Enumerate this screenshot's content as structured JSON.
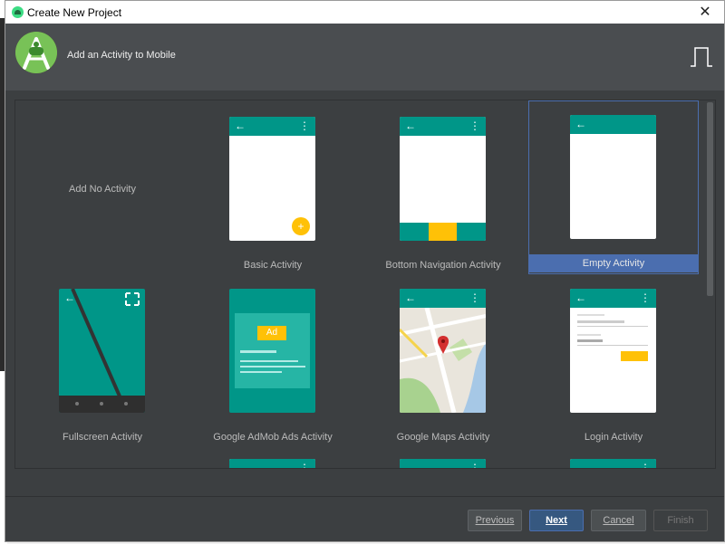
{
  "window": {
    "title": "Create New Project"
  },
  "header": {
    "title": "Add an Activity to Mobile"
  },
  "activities": [
    {
      "name": "Add No Activity",
      "selected": false
    },
    {
      "name": "Basic Activity",
      "selected": false
    },
    {
      "name": "Bottom Navigation Activity",
      "selected": false
    },
    {
      "name": "Empty Activity",
      "selected": true
    },
    {
      "name": "Fullscreen Activity",
      "selected": false
    },
    {
      "name": "Google AdMob Ads Activity",
      "selected": false
    },
    {
      "name": "Google Maps Activity",
      "selected": false
    },
    {
      "name": "Login Activity",
      "selected": false
    }
  ],
  "phone_icons": {
    "back": "←",
    "overflow": "⋮",
    "fab": "+"
  },
  "admob": {
    "ad_label": "Ad"
  },
  "buttons": {
    "previous": "Previous",
    "next": "Next",
    "cancel": "Cancel",
    "finish": "Finish"
  },
  "colors": {
    "primary": "#009688",
    "accent": "#ffc107",
    "selection": "#4b6eaf",
    "background": "#3c3f41"
  }
}
